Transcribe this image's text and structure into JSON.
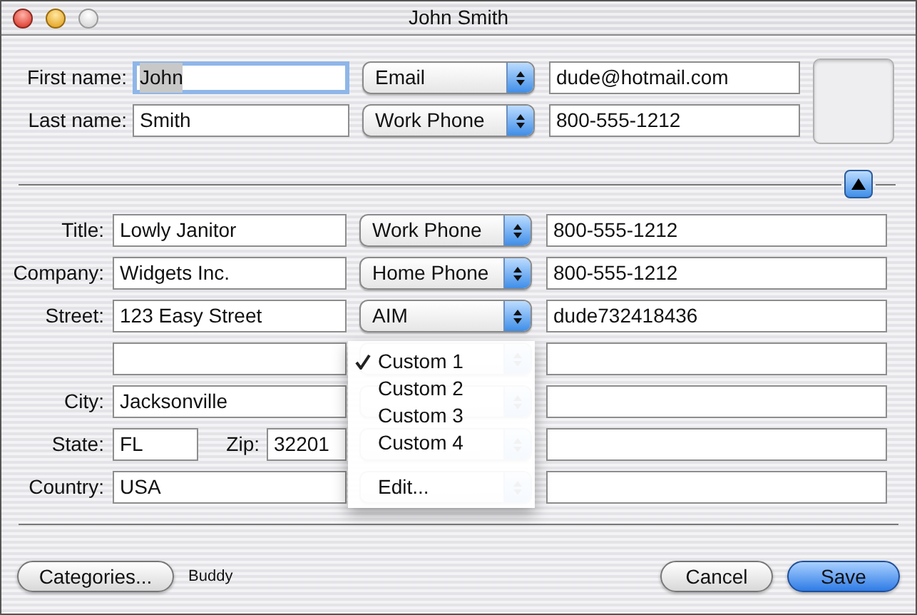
{
  "window": {
    "title": "John Smith"
  },
  "name_rows": [
    {
      "label": "First name:",
      "value": "John",
      "focused": true,
      "contact_type": "Email",
      "contact_value": "dude@hotmail.com"
    },
    {
      "label": "Last name:",
      "value": "Smith",
      "focused": false,
      "contact_type": "Work Phone",
      "contact_value": "800-555-1212"
    }
  ],
  "detail_rows": [
    {
      "kind": "field",
      "label": "Title:",
      "value": "Lowly Janitor",
      "contact_type": "Work Phone",
      "contact_value": "800-555-1212"
    },
    {
      "kind": "field",
      "label": "Company:",
      "value": "Widgets Inc.",
      "contact_type": "Home Phone",
      "contact_value": "800-555-1212"
    },
    {
      "kind": "field",
      "label": "Street:",
      "value": "123 Easy Street",
      "contact_type": "AIM",
      "contact_value": "dude732418436"
    },
    {
      "kind": "field"
    },
    {
      "kind": "field",
      "label": "City:",
      "value": "Jacksonville"
    },
    {
      "kind": "pair",
      "label": "State:",
      "value": "FL",
      "label_2": "Zip:",
      "value_2": "32201"
    },
    {
      "kind": "field",
      "label": "Country:",
      "value": "USA"
    }
  ],
  "popup_menu": {
    "items": [
      {
        "kind": "item",
        "label": "Custom 1",
        "checked": true
      },
      {
        "kind": "item",
        "label": "Custom 2",
        "checked": false
      },
      {
        "kind": "item",
        "label": "Custom 3",
        "checked": false
      },
      {
        "kind": "item",
        "label": "Custom 4",
        "checked": false
      },
      {
        "kind": "separator"
      },
      {
        "kind": "item",
        "label": "Edit...",
        "checked": false
      }
    ]
  },
  "footer": {
    "categories_button": "Categories...",
    "group": "Buddy",
    "buttons": [
      {
        "label": "Cancel",
        "default": false
      },
      {
        "label": "Save",
        "default": true
      }
    ]
  }
}
